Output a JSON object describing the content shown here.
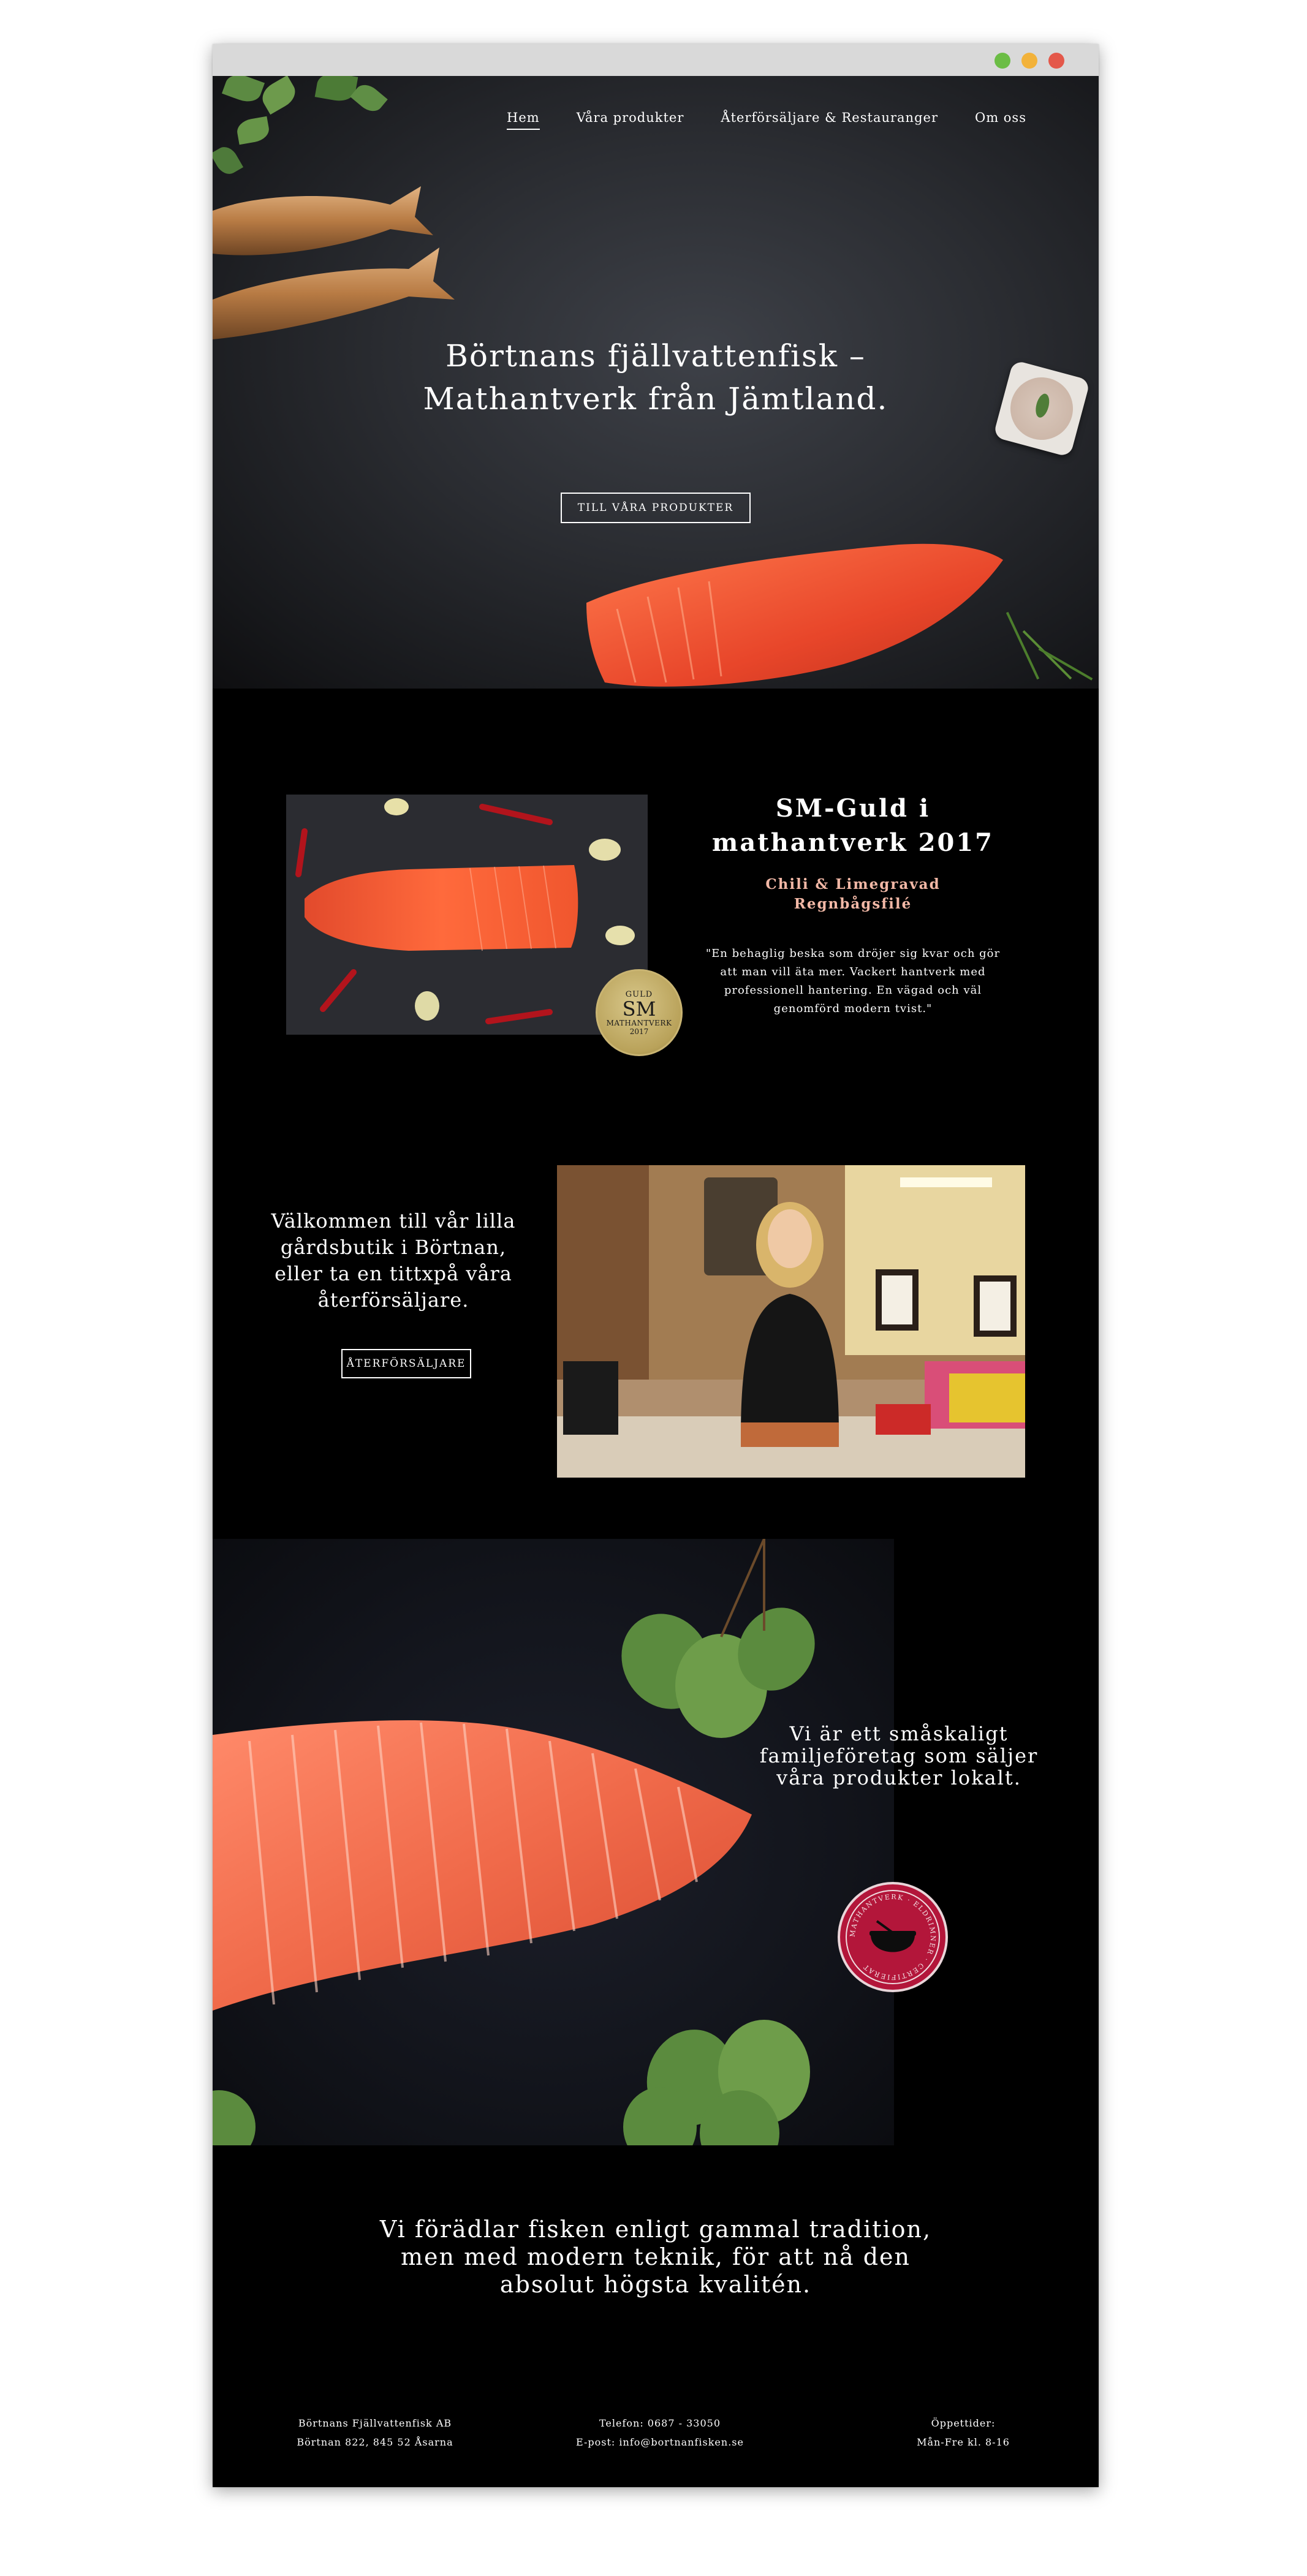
{
  "window": {
    "controls": [
      "minimize",
      "maximize",
      "close"
    ]
  },
  "nav": {
    "items": [
      {
        "label": "Hem",
        "active": true
      },
      {
        "label": "Våra produkter",
        "active": false
      },
      {
        "label": "Återförsäljare & Restauranger",
        "active": false
      },
      {
        "label": "Om oss",
        "active": false
      }
    ]
  },
  "hero": {
    "title_line1": "Börtnans fjällvattenfisk –",
    "title_line2": "Mathantverk från Jämtland.",
    "button": "TILL VÅRA PRODUKTER"
  },
  "award": {
    "heading_line1": "SM-Guld i",
    "heading_line2": "mathantverk 2017",
    "subtitle_line1": "Chili & Limegravad",
    "subtitle_line2": "Regnbågsfilé",
    "quote": "\"En behaglig beska som dröjer sig kvar och gör att man vill äta mer. Vackert hantverk med professionell hantering. En vägad och väl genomförd modern tvist.\"",
    "badge_top": "GULD",
    "badge_mid": "SM",
    "badge_text": "MATHANTVERK",
    "badge_year": "2017"
  },
  "shop": {
    "text_line1": "Välkommen till vår lilla",
    "text_line2": "gårdsbutik i Börtnan,",
    "text_line3": "eller ta en tittxpå våra",
    "text_line4": "återförsäljare.",
    "button": "ÅTERFÖRSÄLJARE"
  },
  "family": {
    "text_line1": "Vi är ett småskaligt",
    "text_line2": "familjeföretag som säljer",
    "text_line3": "våra produkter lokalt.",
    "badge_text": "MATHANTVERK · ELDRIMNER · CERTIFIERAT"
  },
  "tradition": {
    "line1": "Vi förädlar fisken enligt gammal tradition,",
    "line2": "men med modern teknik, för att nå den",
    "line3": "absolut högsta kvalitén."
  },
  "footer": {
    "company": "Börtnans Fjällvattenfisk AB",
    "address": "Börtnan 822, 845 52 Åsarna",
    "phone": "Telefon: 0687 - 33050",
    "email": "E-post: info@bortnanfisken.se",
    "hours_label": "Öppettider:",
    "hours": "Mån-Fre kl. 8-16"
  },
  "colors": {
    "background": "#000000",
    "accent_pink": "#f2b8a6",
    "salmon": "#e8502e",
    "badge_red": "#b3163a",
    "badge_gold": "#c9b472"
  }
}
